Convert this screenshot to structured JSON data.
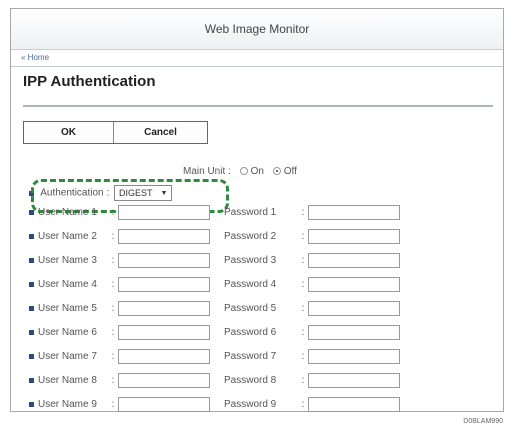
{
  "window": {
    "title": "Web Image Monitor"
  },
  "nav": {
    "home": "« Home"
  },
  "page": {
    "title": "IPP Authentication"
  },
  "buttons": {
    "ok": "OK",
    "cancel": "Cancel"
  },
  "setting_row": {
    "label": "Main Unit :",
    "on": "On",
    "off": "Off",
    "selected": "Off"
  },
  "auth": {
    "label": "Authentication :",
    "value": "DIGEST"
  },
  "users": [
    {
      "user": "User Name 1",
      "pass": "Password 1"
    },
    {
      "user": "User Name 2",
      "pass": "Password 2"
    },
    {
      "user": "User Name 3",
      "pass": "Password 3"
    },
    {
      "user": "User Name 4",
      "pass": "Password 4"
    },
    {
      "user": "User Name 5",
      "pass": "Password 5"
    },
    {
      "user": "User Name 6",
      "pass": "Password 6"
    },
    {
      "user": "User Name 7",
      "pass": "Password 7"
    },
    {
      "user": "User Name 8",
      "pass": "Password 8"
    },
    {
      "user": "User Name 9",
      "pass": "Password 9"
    }
  ],
  "colon": ":",
  "figure_id": "D0BLAM990",
  "colors": {
    "highlight": "#2e8b3d",
    "bullet": "#2d4a7a"
  }
}
